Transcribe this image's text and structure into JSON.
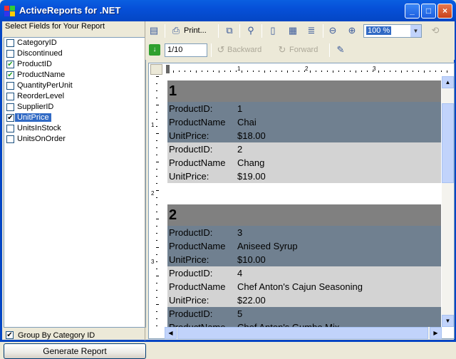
{
  "window": {
    "title": "ActiveReports for .NET",
    "minimize": "_",
    "maximize": "□",
    "close": "×"
  },
  "left": {
    "label": "Select Fields for Your Report",
    "fields": [
      {
        "name": "CategoryID",
        "checked": false
      },
      {
        "name": "Discontinued",
        "checked": false
      },
      {
        "name": "ProductID",
        "checked": true
      },
      {
        "name": "ProductName",
        "checked": true
      },
      {
        "name": "QuantityPerUnit",
        "checked": false
      },
      {
        "name": "ReorderLevel",
        "checked": false
      },
      {
        "name": "SupplierID",
        "checked": false
      },
      {
        "name": "UnitPrice",
        "checked": true,
        "selected": true
      },
      {
        "name": "UnitsInStock",
        "checked": false
      },
      {
        "name": "UnitsOnOrder",
        "checked": false
      }
    ],
    "group_label": "Group By Category ID",
    "generate_label": "Generate Report"
  },
  "toolbar": {
    "print_label": "Print...",
    "zoom_value": "100 %",
    "page_value": "1/10",
    "backward_label": "Backward",
    "forward_label": "Forward"
  },
  "ruler": {
    "h_marks": [
      "1",
      "2",
      "3"
    ],
    "v_marks": [
      "1",
      "2",
      "3"
    ]
  },
  "report": {
    "groups": [
      {
        "id": "1",
        "products": [
          {
            "ProductID": "1",
            "ProductName": "Chai",
            "UnitPrice": "$18.00"
          },
          {
            "ProductID": "2",
            "ProductName": "Chang",
            "UnitPrice": "$19.00"
          }
        ]
      },
      {
        "id": "2",
        "products": [
          {
            "ProductID": "3",
            "ProductName": "Aniseed Syrup",
            "UnitPrice": "$10.00"
          },
          {
            "ProductID": "4",
            "ProductName": "Chef Anton's Cajun Seasoning",
            "UnitPrice": "$22.00"
          },
          {
            "ProductID": "5",
            "ProductName": "Chef Anton's Gumbo Mix",
            "UnitPrice": ""
          }
        ]
      }
    ],
    "labels": {
      "id": "ProductID:",
      "name": "ProductName",
      "price": "UnitPrice:"
    }
  },
  "colors": {
    "title": "#0446c4",
    "dark_band": "#708090",
    "light_band": "#d3d3d3",
    "header_band": "#808080",
    "selection": "#316ac5"
  }
}
